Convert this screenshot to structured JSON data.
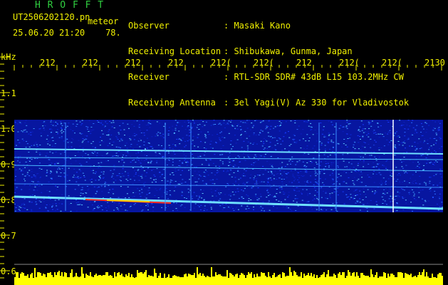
{
  "header": {
    "title": "H R O F F T",
    "file_name": "UT2506202120.pn",
    "meteor_label": "meteor",
    "timestamp": "25.06.20 21:20",
    "count": "78.",
    "info": [
      {
        "key": "Observer",
        "value": ": Masaki Kano"
      },
      {
        "key": "Receiving Location",
        "value": ": Shibukawa, Gunma, Japan"
      },
      {
        "key": "Receiver",
        "value": ": RTL-SDR SDR# 43dB L15 103.2MHz CW"
      },
      {
        "key": "Receiving Antenna",
        "value": ": 3el Yagi(V) Az 330 for Vladivostok"
      }
    ]
  },
  "axes": {
    "y_unit": "kHz",
    "y_ticks": [
      "1.1",
      "1.0",
      "0.9",
      "0.8",
      "0.7",
      "0.6"
    ],
    "x_ticks": [
      "212",
      "212",
      "212",
      "212",
      "212(",
      "212(",
      "212",
      "212(",
      "212(",
      "2130"
    ]
  },
  "colors": {
    "text_yellow": "#f0f000",
    "text_white": "#e8e8e8",
    "title_green": "#30d040",
    "background": "#000000",
    "spectrogram_base": "#0a1fb0",
    "echo_line": "#ffffff"
  }
}
